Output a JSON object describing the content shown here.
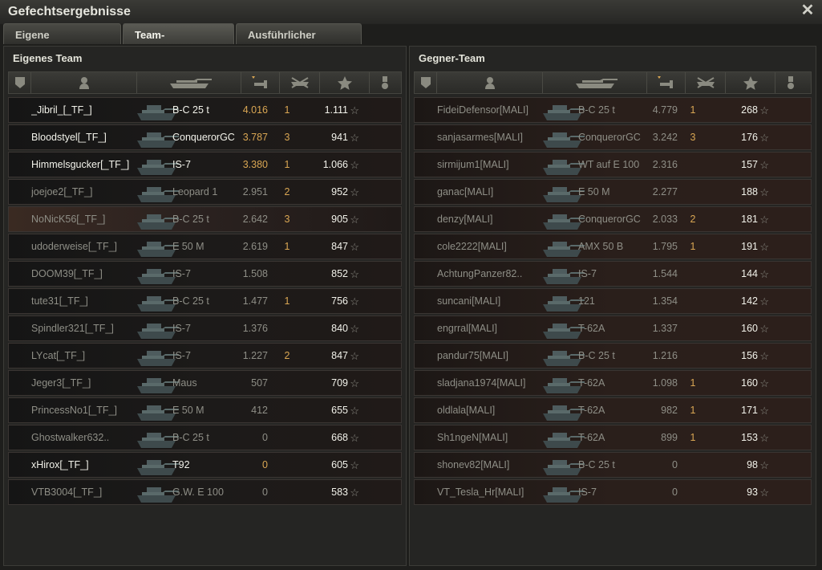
{
  "window": {
    "title": "Gefechtsergebnisse"
  },
  "tabs": [
    {
      "label": "Eigene Auswertung"
    },
    {
      "label": "Team-Auswertung"
    },
    {
      "label": "Ausführlicher Bericht"
    }
  ],
  "own_team": {
    "title": "Eigenes Team",
    "rows": [
      {
        "player": "_Jibril_[_TF_]",
        "tank": "B-C 25 t",
        "xp": "4.016",
        "kills": "1",
        "damage": "1.111",
        "alive": true
      },
      {
        "player": "Bloodstyel[_TF_]",
        "tank": "ConquerorGC",
        "xp": "3.787",
        "kills": "3",
        "damage": "941",
        "alive": true
      },
      {
        "player": "Himmelsgucker[_TF_]",
        "tank": "IS-7",
        "xp": "3.380",
        "kills": "1",
        "damage": "1.066",
        "alive": true
      },
      {
        "player": "joejoe2[_TF_]",
        "tank": "Leopard 1",
        "xp": "2.951",
        "kills": "2",
        "damage": "952",
        "alive": false
      },
      {
        "player": "NoNicK56[_TF_]",
        "tank": "B-C 25 t",
        "xp": "2.642",
        "kills": "3",
        "damage": "905",
        "alive": false
      },
      {
        "player": "udoderweise[_TF_]",
        "tank": "E 50 M",
        "xp": "2.619",
        "kills": "1",
        "damage": "847",
        "alive": false
      },
      {
        "player": "DOOM39[_TF_]",
        "tank": "IS-7",
        "xp": "1.508",
        "kills": "",
        "damage": "852",
        "alive": false
      },
      {
        "player": "tute31[_TF_]",
        "tank": "B-C 25 t",
        "xp": "1.477",
        "kills": "1",
        "damage": "756",
        "alive": false
      },
      {
        "player": "Spindler321[_TF_]",
        "tank": "IS-7",
        "xp": "1.376",
        "kills": "",
        "damage": "840",
        "alive": false
      },
      {
        "player": "LYcat[_TF_]",
        "tank": "IS-7",
        "xp": "1.227",
        "kills": "2",
        "damage": "847",
        "alive": false
      },
      {
        "player": "Jeger3[_TF_]",
        "tank": "Maus",
        "xp": "507",
        "kills": "",
        "damage": "709",
        "alive": false
      },
      {
        "player": "PrincessNo1[_TF_]",
        "tank": "E 50 M",
        "xp": "412",
        "kills": "",
        "damage": "655",
        "alive": false
      },
      {
        "player": "Ghostwalker632..",
        "tank": "B-C 25 t",
        "xp": "0",
        "kills": "",
        "damage": "668",
        "alive": false
      },
      {
        "player": "xHirox[_TF_]",
        "tank": "T92",
        "xp": "0",
        "kills": "",
        "damage": "605",
        "alive": true
      },
      {
        "player": "VTB3004[_TF_]",
        "tank": "G.W. E 100",
        "xp": "0",
        "kills": "",
        "damage": "583",
        "alive": false
      }
    ]
  },
  "enemy_team": {
    "title": "Gegner-Team",
    "rows": [
      {
        "player": "FideiDefensor[MALI]",
        "tank": "B-C 25 t",
        "xp": "4.779",
        "kills": "1",
        "damage": "268"
      },
      {
        "player": "sanjasarmes[MALI]",
        "tank": "ConquerorGC",
        "xp": "3.242",
        "kills": "3",
        "damage": "176"
      },
      {
        "player": "sirmijum1[MALI]",
        "tank": "WT auf E 100",
        "xp": "2.316",
        "kills": "",
        "damage": "157"
      },
      {
        "player": "ganac[MALI]",
        "tank": "E 50 M",
        "xp": "2.277",
        "kills": "",
        "damage": "188"
      },
      {
        "player": "denzy[MALI]",
        "tank": "ConquerorGC",
        "xp": "2.033",
        "kills": "2",
        "damage": "181"
      },
      {
        "player": "cole2222[MALI]",
        "tank": "AMX 50 B",
        "xp": "1.795",
        "kills": "1",
        "damage": "191"
      },
      {
        "player": "AchtungPanzer82..",
        "tank": "IS-7",
        "xp": "1.544",
        "kills": "",
        "damage": "144"
      },
      {
        "player": "suncani[MALI]",
        "tank": "121",
        "xp": "1.354",
        "kills": "",
        "damage": "142"
      },
      {
        "player": "engrral[MALI]",
        "tank": "T-62A",
        "xp": "1.337",
        "kills": "",
        "damage": "160"
      },
      {
        "player": "pandur75[MALI]",
        "tank": "B-C 25 t",
        "xp": "1.216",
        "kills": "",
        "damage": "156"
      },
      {
        "player": "sladjana1974[MALI]",
        "tank": "T-62A",
        "xp": "1.098",
        "kills": "1",
        "damage": "160"
      },
      {
        "player": "oldlala[MALI]",
        "tank": "T-62A",
        "xp": "982",
        "kills": "1",
        "damage": "171"
      },
      {
        "player": "Sh1ngeN[MALI]",
        "tank": "T-62A",
        "xp": "899",
        "kills": "1",
        "damage": "153"
      },
      {
        "player": "shonev82[MALI]",
        "tank": "B-C 25 t",
        "xp": "0",
        "kills": "",
        "damage": "98"
      },
      {
        "player": "VT_Tesla_Hr[MALI]",
        "tank": "IS-7",
        "xp": "0",
        "kills": "",
        "damage": "93"
      }
    ]
  },
  "columns": {
    "icons": [
      "squad-icon",
      "player-icon",
      "tank-icon",
      "xp-sort-icon",
      "kills-icon",
      "damage-star-icon",
      "medal-icon"
    ]
  },
  "icons": {
    "star": "☆",
    "close": "✕"
  },
  "colors": {
    "gold": "#d9a653",
    "alive_text": "#f2f2ea",
    "dead_text": "#8e8e86"
  }
}
